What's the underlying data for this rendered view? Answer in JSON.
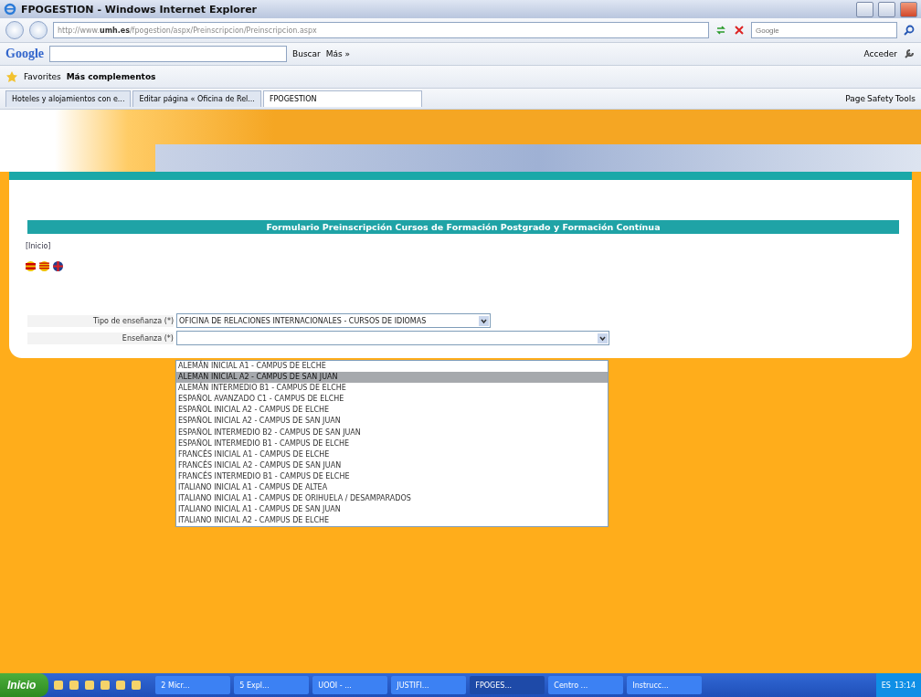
{
  "window": {
    "title": "FPOGESTION - Windows Internet Explorer"
  },
  "address_bar": {
    "url": "http://www.**umh.es**/fpogestion/aspx/Preinscripcion/Preinscripcion.aspx",
    "search_placeholder": "Google"
  },
  "google_toolbar": {
    "logo": "Google",
    "search_button": "Buscar",
    "more": "Más »",
    "sign_in": "Acceder"
  },
  "favorites_bar": {
    "favorites": "Favorites",
    "item": "Más complementos"
  },
  "tabs": [
    {
      "label": "Hoteles y alojamientos con e...",
      "selected": false
    },
    {
      "label": "Editar página « Oficina de Rel...",
      "selected": false
    },
    {
      "label": "FPOGESTION",
      "selected": true
    }
  ],
  "command_bar": [
    "Page",
    "Safety",
    "Tools"
  ],
  "page": {
    "heading": "Formulario Preinscripción Cursos de Formación Postgrado y Formación Contínua",
    "home_link": "[Inicio]",
    "fields": [
      {
        "label": "Tipo de enseñanza (*)",
        "value": "OFICINA DE RELACIONES INTERNACIONALES - CURSOS DE IDIOMAS",
        "kind": "short"
      },
      {
        "label": "Enseñanza (*)",
        "kind": "wide"
      }
    ],
    "dropdown_options": [
      {
        "label": "ALEMÁN INICIAL A1 - CAMPUS DE ELCHE",
        "selected": false
      },
      {
        "label": "ALEMAN INICIAL A2 - CAMPUS DE SAN JUAN",
        "selected": true
      },
      {
        "label": "ALEMÁN INTERMEDIO B1 - CAMPUS DE ELCHE",
        "selected": false
      },
      {
        "label": "ESPAÑOL AVANZADO C1 - CAMPUS DE ELCHE",
        "selected": false
      },
      {
        "label": "ESPAÑOL INICIAL A2 - CAMPUS DE ELCHE",
        "selected": false
      },
      {
        "label": "ESPAÑOL INICIAL A2 - CAMPUS DE SAN JUAN",
        "selected": false
      },
      {
        "label": "ESPAÑOL INTERMEDIO B2 - CAMPUS DE SAN JUAN",
        "selected": false
      },
      {
        "label": "ESPAÑOL INTERMEDIO B1 - CAMPUS DE ELCHE",
        "selected": false
      },
      {
        "label": "FRANCÉS INICIAL A1 - CAMPUS DE ELCHE",
        "selected": false
      },
      {
        "label": "FRANCÉS INICIAL A2 - CAMPUS DE SAN JUAN",
        "selected": false
      },
      {
        "label": "FRANCÉS INTERMEDIO B1 - CAMPUS DE ELCHE",
        "selected": false
      },
      {
        "label": "ITALIANO INICIAL A1 - CAMPUS DE ALTEA",
        "selected": false
      },
      {
        "label": "ITALIANO INICIAL A1 - CAMPUS DE ORIHUELA / DESAMPARADOS",
        "selected": false
      },
      {
        "label": "ITALIANO INICIAL A1 - CAMPUS DE SAN JUAN",
        "selected": false
      },
      {
        "label": "ITALIANO INICIAL A2 - CAMPUS DE ELCHE",
        "selected": false
      }
    ]
  },
  "taskbar": {
    "start": "Inicio",
    "items": [
      {
        "label": "2 Micr...",
        "selected": false
      },
      {
        "label": "5 Expl...",
        "selected": false
      },
      {
        "label": "UOOI - ...",
        "selected": false
      },
      {
        "label": "JUSTIFI...",
        "selected": false
      },
      {
        "label": "FPOGES...",
        "selected": true
      },
      {
        "label": "Centro ...",
        "selected": false
      },
      {
        "label": "Instrucc...",
        "selected": false
      }
    ],
    "language": "ES",
    "clock": "13:14"
  }
}
